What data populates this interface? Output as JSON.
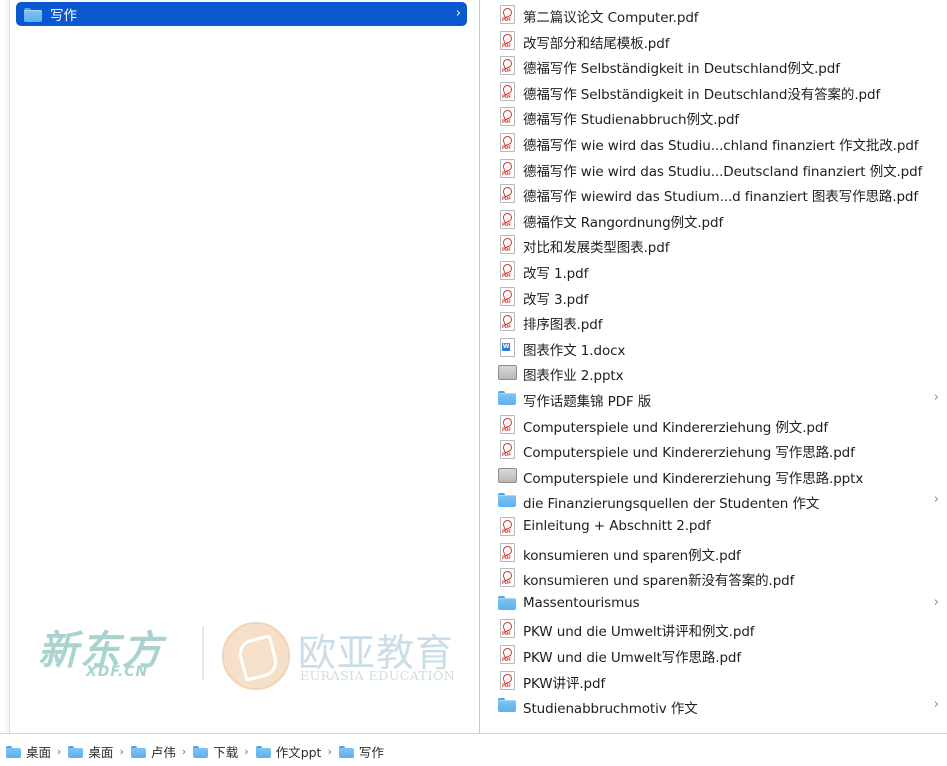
{
  "left_column": {
    "selected_folder": "写作"
  },
  "right_column": {
    "items": [
      {
        "label": "第二篇议论文 Computer.pdf",
        "type": "pdf"
      },
      {
        "label": "改写部分和结尾模板.pdf",
        "type": "pdf"
      },
      {
        "label": "德福写作 Selbständigkeit in Deutschland例文.pdf",
        "type": "pdf"
      },
      {
        "label": "德福写作 Selbständigkeit in Deutschland没有答案的.pdf",
        "type": "pdf"
      },
      {
        "label": "德福写作 Studienabbruch例文.pdf",
        "type": "pdf"
      },
      {
        "label": "德福写作 wie wird das Studiu...chland finanziert 作文批改.pdf",
        "type": "pdf"
      },
      {
        "label": "德福写作 wie wird das Studiu...Deutscland finanziert 例文.pdf",
        "type": "pdf"
      },
      {
        "label": "德福写作 wiewird das Studium...d finanziert 图表写作思路.pdf",
        "type": "pdf"
      },
      {
        "label": "德福作文 Rangordnung例文.pdf",
        "type": "pdf"
      },
      {
        "label": "对比和发展类型图表.pdf",
        "type": "pdf"
      },
      {
        "label": "改写 1.pdf",
        "type": "pdf"
      },
      {
        "label": "改写 3.pdf",
        "type": "pdf"
      },
      {
        "label": "排序图表.pdf",
        "type": "pdf"
      },
      {
        "label": "图表作文 1.docx",
        "type": "docx"
      },
      {
        "label": "图表作业 2.pptx",
        "type": "pptx"
      },
      {
        "label": "写作话题集锦 PDF 版",
        "type": "folder"
      },
      {
        "label": "Computerspiele und Kindererziehung 例文.pdf",
        "type": "pdf"
      },
      {
        "label": "Computerspiele und Kindererziehung 写作思路.pdf",
        "type": "pdf"
      },
      {
        "label": "Computerspiele und Kindererziehung 写作思路.pptx",
        "type": "pptx"
      },
      {
        "label": "die Finanzierungsquellen der Studenten 作文",
        "type": "folder"
      },
      {
        "label": "Einleitung + Abschnitt 2.pdf",
        "type": "pdf"
      },
      {
        "label": "konsumieren und sparen例文.pdf",
        "type": "pdf"
      },
      {
        "label": "konsumieren und sparen新没有答案的.pdf",
        "type": "pdf"
      },
      {
        "label": "Massentourismus",
        "type": "folder"
      },
      {
        "label": "PKW und die Umwelt讲评和例文.pdf",
        "type": "pdf"
      },
      {
        "label": "PKW und die Umwelt写作思路.pdf",
        "type": "pdf"
      },
      {
        "label": "PKW讲评.pdf",
        "type": "pdf"
      },
      {
        "label": "Studienabbruchmotiv 作文",
        "type": "folder"
      }
    ]
  },
  "watermark": {
    "brand": "新东方",
    "brand_sub": "XDF.CN",
    "title": "欧亚教育",
    "title_en": "EURASIA EDUCATION"
  },
  "path_bar": {
    "crumbs": [
      "桌面",
      "桌面",
      "卢伟",
      "下载",
      "作文ppt",
      "写作"
    ],
    "separator": "›"
  },
  "icons": {
    "chevron": "›"
  },
  "colors": {
    "selection": "#0b57d0",
    "folder": "#5db0ec",
    "pdf_accent": "#d63b2f"
  }
}
